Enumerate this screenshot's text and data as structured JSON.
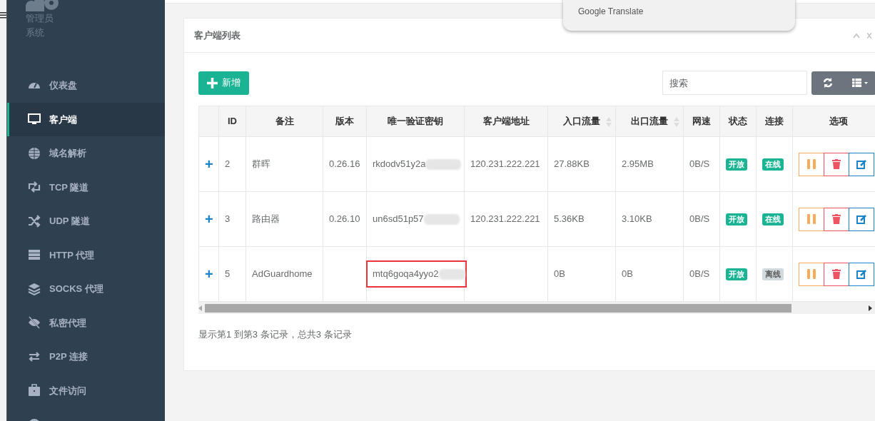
{
  "sidebar": {
    "user": {
      "name": "管理员",
      "role": "系统"
    },
    "items": [
      {
        "label": "仪表盘",
        "kind": "gauge",
        "selected": false
      },
      {
        "label": "客户端",
        "kind": "monitor",
        "selected": true
      },
      {
        "label": "域名解析",
        "kind": "globe",
        "selected": false
      },
      {
        "label": "TCP 隧道",
        "kind": "retweet",
        "selected": false
      },
      {
        "label": "UDP 隧道",
        "kind": "shuffle",
        "selected": false
      },
      {
        "label": "HTTP 代理",
        "kind": "server",
        "selected": false
      },
      {
        "label": "SOCKS 代理",
        "kind": "layers",
        "selected": false
      },
      {
        "label": "私密代理",
        "kind": "eyeslash",
        "selected": false
      },
      {
        "label": "P2P 连接",
        "kind": "exchange",
        "selected": false
      },
      {
        "label": "文件访问",
        "kind": "briefcase",
        "selected": false
      },
      {
        "kind": "info",
        "selected": false
      }
    ]
  },
  "translate_popup": {
    "label": "Google Translate"
  },
  "panel": {
    "title": "客户端列表",
    "add_button": "新增",
    "search": {
      "placeholder": "搜索"
    },
    "table": {
      "columns": [
        {
          "label": "ID"
        },
        {
          "label": "备注"
        },
        {
          "label": "版本"
        },
        {
          "label": "唯一验证密钥"
        },
        {
          "label": "客户端地址"
        },
        {
          "label": "入口流量",
          "sortable": true
        },
        {
          "label": "出口流量",
          "sortable": true
        },
        {
          "label": "网速"
        },
        {
          "label": "状态"
        },
        {
          "label": "连接"
        },
        {
          "label": "选项"
        }
      ],
      "rows": [
        {
          "expand": "+",
          "id": "2",
          "remark": "群晖",
          "version": "0.26.16",
          "key": "rkdodv51y2a",
          "key_redacted": true,
          "highlighted": false,
          "address": "120.231.222.221",
          "inbound": "27.88KB",
          "outbound": "2.95MB",
          "speed": "0B/S",
          "status": "开放",
          "status_open": true,
          "connection": "在线",
          "online": true
        },
        {
          "expand": "+",
          "id": "3",
          "remark": "路由器",
          "version": "0.26.10",
          "key": "un6sd51p57",
          "key_redacted": true,
          "highlighted": false,
          "address": "120.231.222.221",
          "inbound": "5.36KB",
          "outbound": "3.10KB",
          "speed": "0B/S",
          "status": "开放",
          "status_open": true,
          "connection": "在线",
          "online": true
        },
        {
          "expand": "+",
          "id": "5",
          "remark": "AdGuardhome",
          "key": "mtq6goqa4yyo2",
          "key_redacted": true,
          "highlighted": true,
          "inbound": "0B",
          "outbound": "0B",
          "speed": "0B/S",
          "status": "开放",
          "status_open": true,
          "connection": "离线",
          "online": false
        }
      ]
    },
    "footer": "显示第1 到第3 条记录，总共3 条记录"
  }
}
